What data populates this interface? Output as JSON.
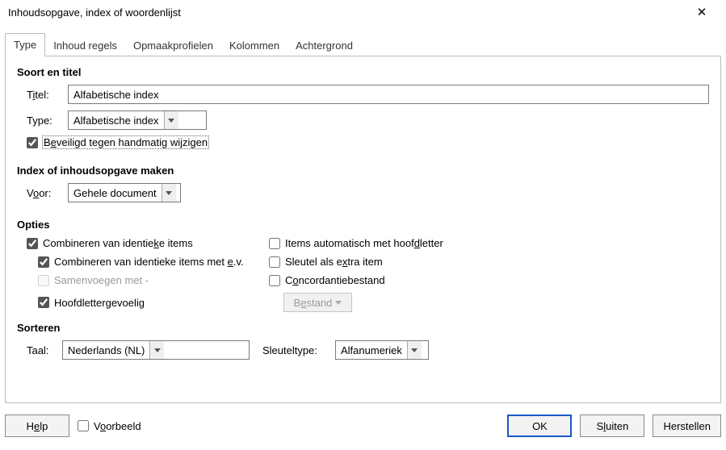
{
  "window": {
    "title": "Inhoudsopgave, index of woordenlijst"
  },
  "tabs": {
    "type": "Type",
    "inhoud_regels": "Inhoud regels",
    "opmaakprofielen": "Opmaakprofielen",
    "kolommen": "Kolommen",
    "achtergrond": "Achtergrond"
  },
  "section_soort": {
    "heading": "Soort en titel"
  },
  "fields": {
    "titel_label_pre": "T",
    "titel_label_u": "i",
    "titel_label_post": "tel:",
    "titel_value": "Alfabetische index",
    "type_label": "Type:",
    "type_value": "Alfabetische index",
    "protect_pre": "B",
    "protect_u": "e",
    "protect_post": "veiligd tegen handmatig wijzigen"
  },
  "section_maken": {
    "heading": "Index of inhoudsopgave maken",
    "voor_pre": "V",
    "voor_u": "o",
    "voor_post": "or:",
    "voor_value": "Gehele document"
  },
  "section_opties": {
    "heading": "Opties",
    "combine_pre": "Combineren van identie",
    "combine_u": "k",
    "combine_post": "e items",
    "combine_ev_pre": "Combineren van identieke items met ",
    "combine_ev_u": "e",
    "combine_ev_post": ".v.",
    "merge_with": "Samenvoegen met -",
    "case_sens": "Hoofdlettergevoelig",
    "auto_upper_pre": "Items automatisch met hoof",
    "auto_upper_u": "d",
    "auto_upper_post": "letter",
    "key_extra_pre": "Sleutel als e",
    "key_extra_u": "x",
    "key_extra_post": "tra item",
    "concord_pre": "C",
    "concord_u": "o",
    "concord_post": "ncordantiebestand",
    "bestand_pre": "B",
    "bestand_u": "e",
    "bestand_post": "stand"
  },
  "section_sorteren": {
    "heading": "Sorteren",
    "taal_label": "Taal:",
    "taal_value": "Nederlands (NL)",
    "sleuteltype_label": "Sleuteltype:",
    "sleuteltype_value": "Alfanumeriek"
  },
  "footer": {
    "help_pre": "H",
    "help_u": "e",
    "help_post": "lp",
    "voorbeeld_pre": "V",
    "voorbeeld_u": "o",
    "voorbeeld_post": "orbeeld",
    "ok": "OK",
    "sluiten_pre": "S",
    "sluiten_u": "l",
    "sluiten_post": "uiten",
    "herstellen": "Herstellen"
  }
}
